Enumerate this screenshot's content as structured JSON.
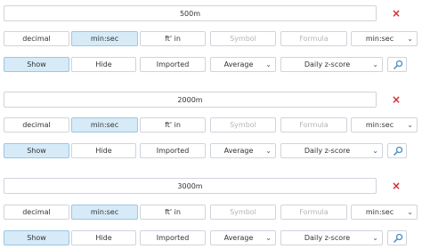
{
  "rows": [
    {
      "name": "500m",
      "remove_icon": "×",
      "formats": [
        "decimal",
        "min:sec",
        "ft' in",
        "Symbol",
        "Formula"
      ],
      "active_format": "min:sec",
      "format_select": "min:sec",
      "toggles": [
        "Show",
        "Hide"
      ],
      "active_toggle": "Show",
      "imported_label": "Imported",
      "aggregate_select": "Average",
      "metric_select": "Daily z-score"
    },
    {
      "name": "2000m",
      "remove_icon": "×",
      "formats": [
        "decimal",
        "min:sec",
        "ft' in",
        "Symbol",
        "Formula"
      ],
      "active_format": "min:sec",
      "format_select": "min:sec",
      "toggles": [
        "Show",
        "Hide"
      ],
      "active_toggle": "Show",
      "imported_label": "Imported",
      "aggregate_select": "Average",
      "metric_select": "Daily z-score"
    },
    {
      "name": "3000m",
      "remove_icon": "×",
      "formats": [
        "decimal",
        "min:sec",
        "ft' in",
        "Symbol",
        "Formula"
      ],
      "active_format": "min:sec",
      "format_select": "min:sec",
      "toggles": [
        "Show",
        "Hide"
      ],
      "active_toggle": "Show",
      "imported_label": "Imported",
      "aggregate_select": "Average",
      "metric_select": "Daily z-score"
    }
  ],
  "icons": {
    "remove": "close-icon",
    "search": "search-icon",
    "dropdown": "chevron-down-icon"
  },
  "colors": {
    "active_bg": "#d6ebf7",
    "remove": "#d62b2b",
    "border": "#cfd4dc"
  }
}
